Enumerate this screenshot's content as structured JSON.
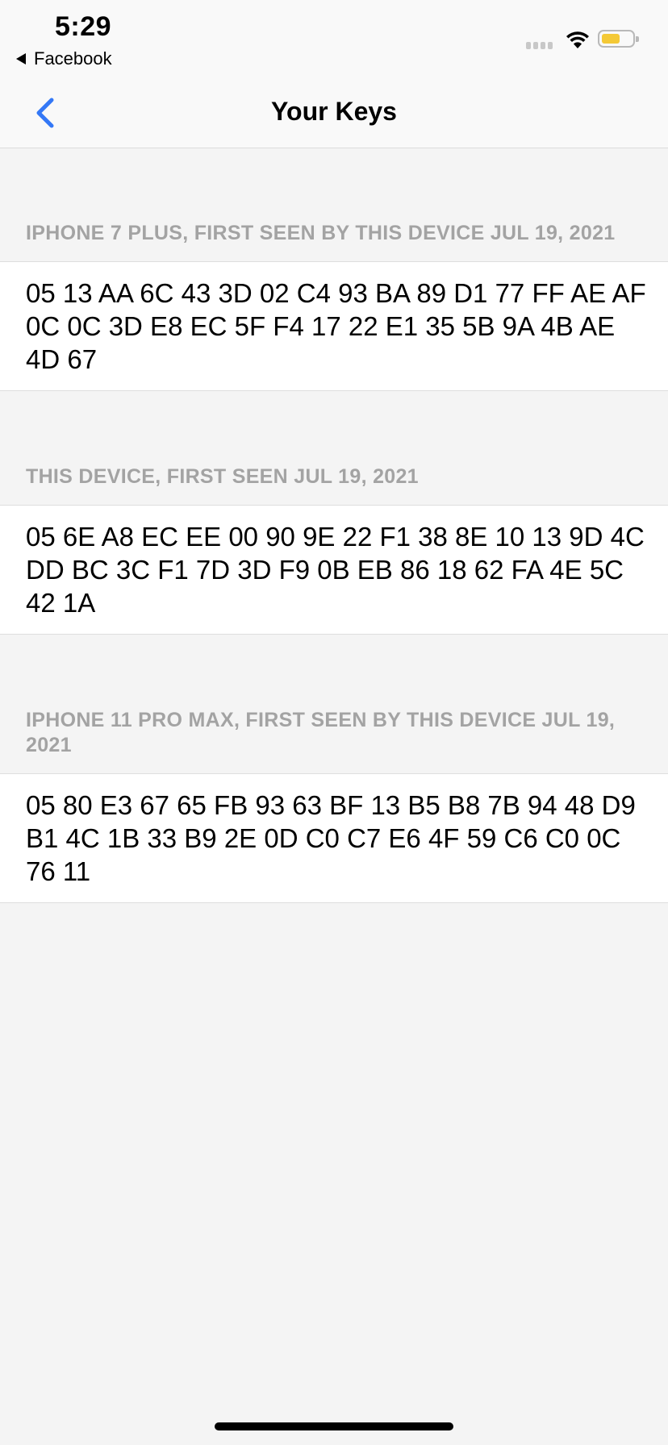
{
  "status_bar": {
    "time": "5:29",
    "back_app": "Facebook"
  },
  "nav": {
    "title": "Your Keys",
    "back_icon": "chevron-left-icon",
    "accent_color": "#3478f6"
  },
  "sections": [
    {
      "header": "IPHONE 7 PLUS, FIRST SEEN BY THIS DEVICE JUL 19, 2021",
      "key": "05 13 AA 6C 43 3D 02 C4 93 BA 89 D1 77 FF AE AF 0C 0C 3D E8 EC 5F F4 17 22 E1 35 5B 9A 4B AE 4D 67"
    },
    {
      "header": "THIS DEVICE, FIRST SEEN JUL 19, 2021",
      "key": "05 6E A8 EC EE 00 90 9E 22 F1 38 8E 10 13 9D 4C DD BC 3C F1 7D 3D F9 0B EB 86 18 62 FA 4E 5C 42 1A"
    },
    {
      "header": "IPHONE 11 PRO MAX, FIRST SEEN BY THIS DEVICE JUL 19, 2021",
      "key": "05 80 E3 67 65 FB 93 63 BF 13 B5 B8 7B 94 48 D9 B1 4C 1B 33 B9 2E 0D C0 C7 E6 4F 59 C6 C0 0C 76 11"
    }
  ]
}
